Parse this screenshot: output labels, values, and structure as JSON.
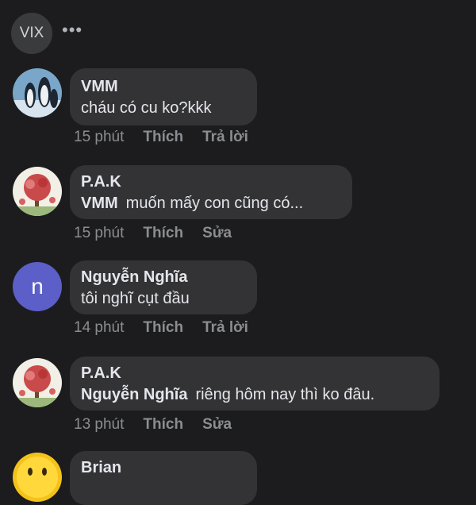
{
  "header": {
    "avatar_label": "VIX",
    "more_icon": "more-horizontal-icon"
  },
  "comments": [
    {
      "author": "VMM",
      "mention": "",
      "text": "cháu có cu ko?kkk",
      "time": "15 phút",
      "like": "Thích",
      "action": "Trả lời",
      "avatar": "penguins"
    },
    {
      "author": "P.A.K",
      "mention": "VMM",
      "text": "muốn mấy con cũng có...",
      "time": "15 phút",
      "like": "Thích",
      "action": "Sửa",
      "avatar": "tree"
    },
    {
      "author": "Nguyễn Nghĩa",
      "mention": "",
      "text": "tôi nghĩ cụt đầu",
      "time": "14 phút",
      "like": "Thích",
      "action": "Trả lời",
      "avatar": "letter",
      "avatar_letter": "n"
    },
    {
      "author": "P.A.K",
      "mention": "Nguyễn Nghĩa",
      "text": "riêng hôm nay thì ko đâu.",
      "time": "13 phút",
      "like": "Thích",
      "action": "Sửa",
      "avatar": "tree"
    },
    {
      "author": "Brian",
      "mention": "",
      "text": "",
      "time": "",
      "like": "",
      "action": "",
      "avatar": "smiley"
    }
  ],
  "colors": {
    "background": "#1c1c1e",
    "bubble": "#333336",
    "meta": "#8a8d91",
    "letter_avatar": "#5b5fc7"
  }
}
